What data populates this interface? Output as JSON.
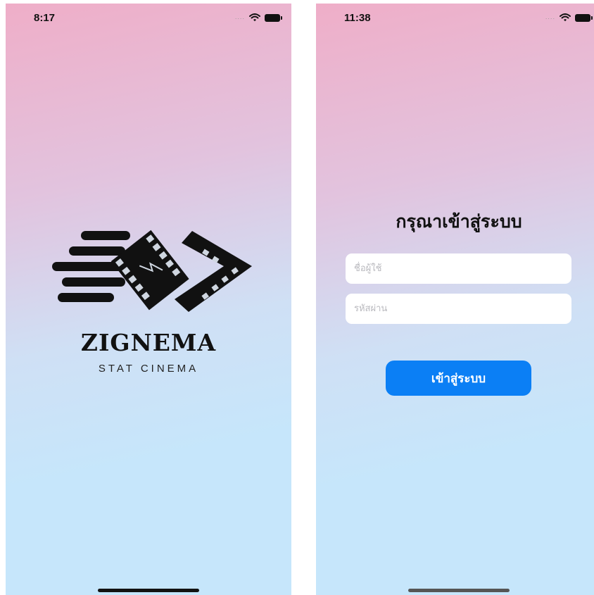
{
  "splash_screen": {
    "status_bar": {
      "time": "8:17",
      "signal": "....",
      "icons": [
        "wifi-icon",
        "battery-icon"
      ]
    },
    "logo": {
      "icon": "film-strip-logo-icon",
      "brand_name": "ZIGNEMA",
      "tagline": "STAT CINEMA"
    }
  },
  "login_screen": {
    "status_bar": {
      "time": "11:38",
      "signal": "....",
      "icons": [
        "wifi-icon",
        "battery-icon"
      ]
    },
    "title": "กรุณาเข้าสู่ระบบ",
    "username": {
      "value": "",
      "placeholder": "ชื่อผู้ใช้"
    },
    "password": {
      "value": "",
      "placeholder": "รหัสผ่าน"
    },
    "submit_label": "เข้าสู่ระบบ"
  },
  "colors": {
    "gradient_top": "#efaec8",
    "gradient_bottom": "#c6e6fb",
    "primary_button": "#0b7ff5",
    "logo_ink": "#111111"
  }
}
